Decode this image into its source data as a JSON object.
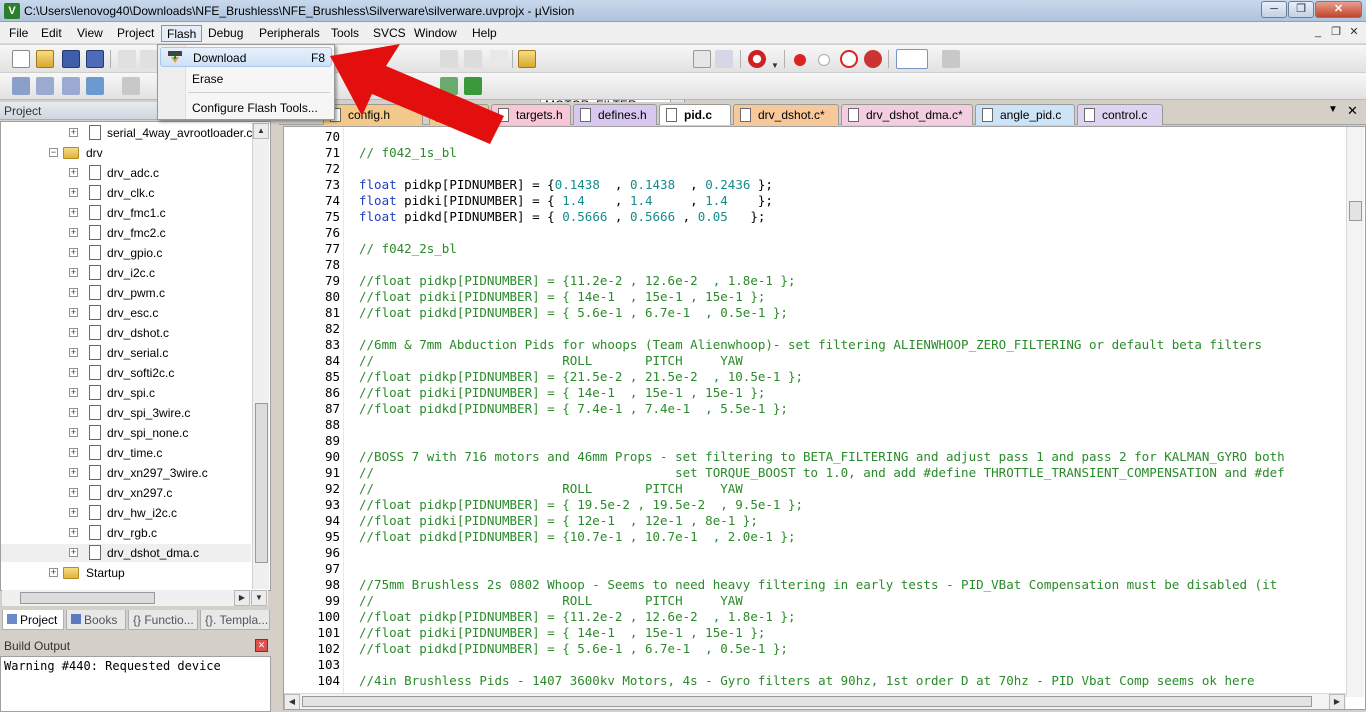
{
  "window": {
    "title": "C:\\Users\\lenovog40\\Downloads\\NFE_Brushless\\NFE_Brushless\\Silverware\\silverware.uvprojx - µVision",
    "min": "─",
    "max": "❐",
    "close": "✕"
  },
  "menu": [
    "File",
    "Edit",
    "View",
    "Project",
    "Flash",
    "Debug",
    "Peripherals",
    "Tools",
    "SVCS",
    "Window",
    "Help"
  ],
  "flash_menu": {
    "download": "Download",
    "download_key": "F8",
    "erase": "Erase",
    "configure": "Configure Flash Tools..."
  },
  "toolbar": {
    "target": "MOTOR_FILTER"
  },
  "project": {
    "header": "Project",
    "tree": [
      {
        "label": "serial_4way_avrootloader.c",
        "type": "file"
      },
      {
        "label": "drv",
        "type": "folder"
      },
      {
        "label": "drv_adc.c",
        "type": "file"
      },
      {
        "label": "drv_clk.c",
        "type": "file"
      },
      {
        "label": "drv_fmc1.c",
        "type": "file"
      },
      {
        "label": "drv_fmc2.c",
        "type": "file"
      },
      {
        "label": "drv_gpio.c",
        "type": "file"
      },
      {
        "label": "drv_i2c.c",
        "type": "file"
      },
      {
        "label": "drv_pwm.c",
        "type": "file"
      },
      {
        "label": "drv_esc.c",
        "type": "file"
      },
      {
        "label": "drv_dshot.c",
        "type": "file"
      },
      {
        "label": "drv_serial.c",
        "type": "file"
      },
      {
        "label": "drv_softi2c.c",
        "type": "file"
      },
      {
        "label": "drv_spi.c",
        "type": "file"
      },
      {
        "label": "drv_spi_3wire.c",
        "type": "file"
      },
      {
        "label": "drv_spi_none.c",
        "type": "file"
      },
      {
        "label": "drv_time.c",
        "type": "file"
      },
      {
        "label": "drv_xn297_3wire.c",
        "type": "file"
      },
      {
        "label": "drv_xn297.c",
        "type": "file"
      },
      {
        "label": "drv_hw_i2c.c",
        "type": "file"
      },
      {
        "label": "drv_rgb.c",
        "type": "file"
      },
      {
        "label": "drv_dshot_dma.c",
        "type": "file"
      },
      {
        "label": "Startup",
        "type": "folder"
      }
    ],
    "tabs": [
      "Project",
      "Books",
      "{} Functio...",
      "{}. Templa..."
    ]
  },
  "build_output": {
    "header": "Build Output",
    "text": "Warning #440: Requested device"
  },
  "editor_tabs": [
    {
      "label": "config.h",
      "color": "#f2c98a"
    },
    {
      "label": "e.h",
      "color": "#f2c98a"
    },
    {
      "label": "targets.h",
      "color": "#f7c7d6"
    },
    {
      "label": "defines.h",
      "color": "#d8c7ef"
    },
    {
      "label": "pid.c",
      "color": "#ffffff"
    },
    {
      "label": "drv_dshot.c*",
      "color": "#f7c99a"
    },
    {
      "label": "drv_dshot_dma.c*",
      "color": "#f3cde0"
    },
    {
      "label": "angle_pid.c",
      "color": "#cde4f7"
    },
    {
      "label": "control.c",
      "color": "#dcd4f0"
    }
  ],
  "code": [
    {
      "n": "70",
      "t": []
    },
    {
      "n": "71",
      "t": [
        [
          "c",
          "// f042_1s_bl"
        ]
      ]
    },
    {
      "n": "72",
      "t": []
    },
    {
      "n": "73",
      "t": [
        [
          "kw",
          "float"
        ],
        [
          "p",
          " pidkp[PIDNUMBER] = {"
        ],
        [
          "num",
          "0.1438"
        ],
        [
          "p",
          "  , "
        ],
        [
          "num",
          "0.1438"
        ],
        [
          "p",
          "  , "
        ],
        [
          "num",
          "0.2436"
        ],
        [
          "p",
          " };"
        ]
      ]
    },
    {
      "n": "74",
      "t": [
        [
          "kw",
          "float"
        ],
        [
          "p",
          " pidki[PIDNUMBER] = { "
        ],
        [
          "num",
          "1.4"
        ],
        [
          "p",
          "    , "
        ],
        [
          "num",
          "1.4"
        ],
        [
          "p",
          "     , "
        ],
        [
          "num",
          "1.4"
        ],
        [
          "p",
          "    };"
        ]
      ]
    },
    {
      "n": "75",
      "t": [
        [
          "kw",
          "float"
        ],
        [
          "p",
          " pidkd[PIDNUMBER] = { "
        ],
        [
          "num",
          "0.5666"
        ],
        [
          "p",
          " , "
        ],
        [
          "num",
          "0.5666"
        ],
        [
          "p",
          " , "
        ],
        [
          "num",
          "0.05"
        ],
        [
          "p",
          "   };"
        ]
      ]
    },
    {
      "n": "76",
      "t": []
    },
    {
      "n": "77",
      "t": [
        [
          "c",
          "// f042_2s_bl"
        ]
      ]
    },
    {
      "n": "78",
      "t": []
    },
    {
      "n": "79",
      "t": [
        [
          "c",
          "//float pidkp[PIDNUMBER] = {11.2e-2 , 12.6e-2  , 1.8e-1 };"
        ]
      ]
    },
    {
      "n": "80",
      "t": [
        [
          "c",
          "//float pidki[PIDNUMBER] = { 14e-1  , 15e-1 , 15e-1 };"
        ]
      ]
    },
    {
      "n": "81",
      "t": [
        [
          "c",
          "//float pidkd[PIDNUMBER] = { 5.6e-1 , 6.7e-1  , 0.5e-1 };"
        ]
      ]
    },
    {
      "n": "82",
      "t": []
    },
    {
      "n": "83",
      "t": [
        [
          "c",
          "//6mm & 7mm Abduction Pids for whoops (Team Alienwhoop)- set filtering ALIENWHOOP_ZERO_FILTERING or default beta filters"
        ]
      ]
    },
    {
      "n": "84",
      "t": [
        [
          "c",
          "//                         ROLL       PITCH     YAW"
        ]
      ]
    },
    {
      "n": "85",
      "t": [
        [
          "c",
          "//float pidkp[PIDNUMBER] = {21.5e-2 , 21.5e-2  , 10.5e-1 };"
        ]
      ]
    },
    {
      "n": "86",
      "t": [
        [
          "c",
          "//float pidki[PIDNUMBER] = { 14e-1  , 15e-1 , 15e-1 };"
        ]
      ]
    },
    {
      "n": "87",
      "t": [
        [
          "c",
          "//float pidkd[PIDNUMBER] = { 7.4e-1 , 7.4e-1  , 5.5e-1 };"
        ]
      ]
    },
    {
      "n": "88",
      "t": []
    },
    {
      "n": "89",
      "t": []
    },
    {
      "n": "90",
      "t": [
        [
          "c",
          "//BOSS 7 with 716 motors and 46mm Props - set filtering to BETA_FILTERING and adjust pass 1 and pass 2 for KALMAN_GYRO both"
        ]
      ]
    },
    {
      "n": "91",
      "t": [
        [
          "c",
          "//                                        set TORQUE_BOOST to 1.0, and add #define THROTTLE_TRANSIENT_COMPENSATION and #def"
        ]
      ]
    },
    {
      "n": "92",
      "t": [
        [
          "c",
          "//                         ROLL       PITCH     YAW"
        ]
      ]
    },
    {
      "n": "93",
      "t": [
        [
          "c",
          "//float pidkp[PIDNUMBER] = { 19.5e-2 , 19.5e-2  , 9.5e-1 };"
        ]
      ]
    },
    {
      "n": "94",
      "t": [
        [
          "c",
          "//float pidki[PIDNUMBER] = { 12e-1  , 12e-1 , 8e-1 };"
        ]
      ]
    },
    {
      "n": "95",
      "t": [
        [
          "c",
          "//float pidkd[PIDNUMBER] = {10.7e-1 , 10.7e-1  , 2.0e-1 };"
        ]
      ]
    },
    {
      "n": "96",
      "t": []
    },
    {
      "n": "97",
      "t": []
    },
    {
      "n": "98",
      "t": [
        [
          "c",
          "//75mm Brushless 2s 0802 Whoop - Seems to need heavy filtering in early tests - PID_VBat Compensation must be disabled (it"
        ]
      ]
    },
    {
      "n": "99",
      "t": [
        [
          "c",
          "//                         ROLL       PITCH     YAW"
        ]
      ]
    },
    {
      "n": "100",
      "t": [
        [
          "c",
          "//float pidkp[PIDNUMBER] = {11.2e-2 , 12.6e-2  , 1.8e-1 };"
        ]
      ]
    },
    {
      "n": "101",
      "t": [
        [
          "c",
          "//float pidki[PIDNUMBER] = { 14e-1  , 15e-1 , 15e-1 };"
        ]
      ]
    },
    {
      "n": "102",
      "t": [
        [
          "c",
          "//float pidkd[PIDNUMBER] = { 5.6e-1 , 6.7e-1  , 0.5e-1 };"
        ]
      ]
    },
    {
      "n": "103",
      "t": []
    },
    {
      "n": "104",
      "t": [
        [
          "c",
          "//4in Brushless Pids - 1407 3600kv Motors, 4s - Gyro filters at 90hz, 1st order D at 70hz - PID Vbat Comp seems ok here"
        ]
      ]
    }
  ]
}
